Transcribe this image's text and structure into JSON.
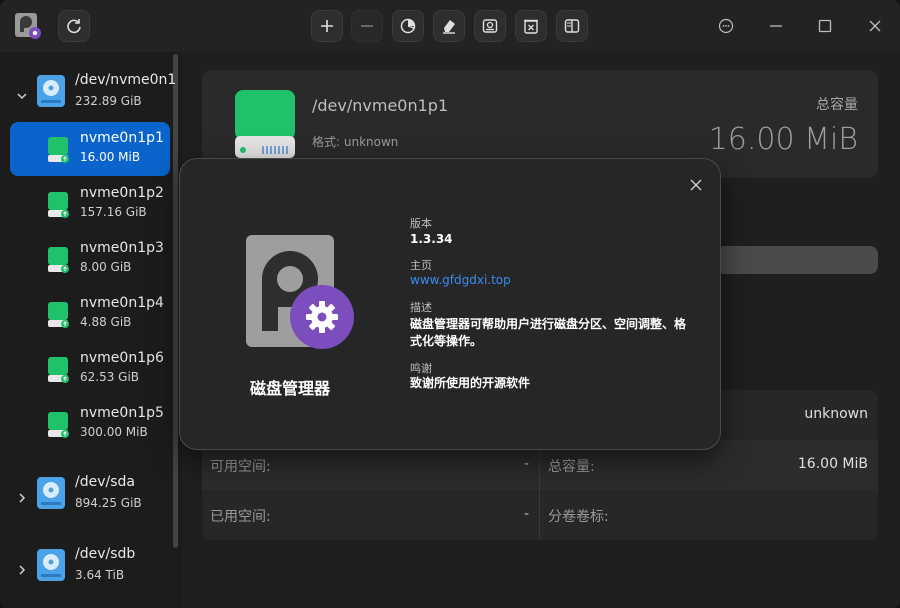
{
  "sidebar": {
    "disks": [
      {
        "name": "/dev/nvme0n1",
        "size": "232.89 GiB",
        "expanded": true
      },
      {
        "name": "/dev/sda",
        "size": "894.25 GiB",
        "expanded": false
      },
      {
        "name": "/dev/sdb",
        "size": "3.64 TiB",
        "expanded": false
      }
    ],
    "partitions": [
      {
        "name": "nvme0n1p1",
        "size": "16.00 MiB",
        "selected": true
      },
      {
        "name": "nvme0n1p2",
        "size": "157.16 GiB"
      },
      {
        "name": "nvme0n1p3",
        "size": "8.00 GiB"
      },
      {
        "name": "nvme0n1p4",
        "size": "4.88 GiB"
      },
      {
        "name": "nvme0n1p6",
        "size": "62.53 GiB"
      },
      {
        "name": "nvme0n1p5",
        "size": "300.00 MiB"
      }
    ]
  },
  "header": {
    "title": "/dev/nvme0n1p1",
    "format": "格式: unknown",
    "capacity_label": "总容量",
    "capacity_value": "16.00 MiB"
  },
  "info": {
    "row0_right_value": "unknown",
    "available_label": "可用空间:",
    "available_value": "-",
    "total_label": "总容量:",
    "total_value": "16.00 MiB",
    "used_label": "已用空间:",
    "used_value": "-",
    "volume_label": "分卷卷标:"
  },
  "about": {
    "app_name": "磁盘管理器",
    "version_label": "版本",
    "version_value": "1.3.34",
    "homepage_label": "主页",
    "homepage_value": "www.gfdgdxi.top",
    "description_label": "描述",
    "description_line1": "磁盘管理器可帮助用户进行磁盘分区、空间调整、格",
    "description_line2": "式化等操作。",
    "thanks_label": "鸣谢",
    "thanks_value": "致谢所使用的开源软件"
  },
  "colors": {
    "accent": "#0a64cc",
    "link": "#3b8cf0",
    "partition_green": "#1fc16b",
    "logo_purple": "#7c4dbd"
  }
}
